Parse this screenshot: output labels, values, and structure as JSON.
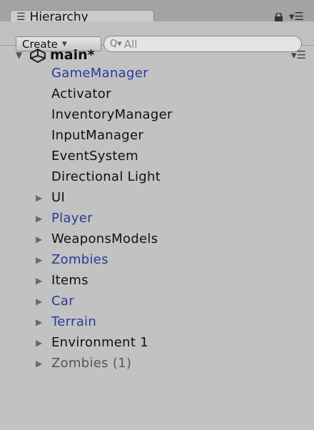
{
  "panel": {
    "tab_label": "Hierarchy",
    "tab_icon": "list-icon",
    "lock_icon": "lock-icon",
    "menu_icon": "menu-icon"
  },
  "toolbar": {
    "create_label": "Create",
    "create_caret": "dropdown-caret-icon",
    "search_placeholder": "All",
    "search_icon": "search-icon"
  },
  "scene": {
    "name": "main*",
    "icon": "unity-icon",
    "fold_icon": "triangle-down-icon",
    "menu_icon": "menu-icon"
  },
  "colors": {
    "prefab": "#2a3a9a",
    "normal": "#111111",
    "inactive": "#555555"
  },
  "items": [
    {
      "label": "GameManager",
      "expandable": false,
      "style": "prefab"
    },
    {
      "label": "Activator",
      "expandable": false,
      "style": "normal"
    },
    {
      "label": "InventoryManager",
      "expandable": false,
      "style": "normal"
    },
    {
      "label": "InputManager",
      "expandable": false,
      "style": "normal"
    },
    {
      "label": "EventSystem",
      "expandable": false,
      "style": "normal"
    },
    {
      "label": "Directional Light",
      "expandable": false,
      "style": "normal"
    },
    {
      "label": "UI",
      "expandable": true,
      "style": "normal"
    },
    {
      "label": "Player",
      "expandable": true,
      "style": "prefab"
    },
    {
      "label": "WeaponsModels",
      "expandable": true,
      "style": "normal"
    },
    {
      "label": "Zombies",
      "expandable": true,
      "style": "prefab"
    },
    {
      "label": "Items",
      "expandable": true,
      "style": "normal"
    },
    {
      "label": "Car",
      "expandable": true,
      "style": "prefab"
    },
    {
      "label": "Terrain",
      "expandable": true,
      "style": "prefab"
    },
    {
      "label": "Environment 1",
      "expandable": true,
      "style": "normal"
    },
    {
      "label": "Zombies (1)",
      "expandable": true,
      "style": "inactive"
    }
  ]
}
